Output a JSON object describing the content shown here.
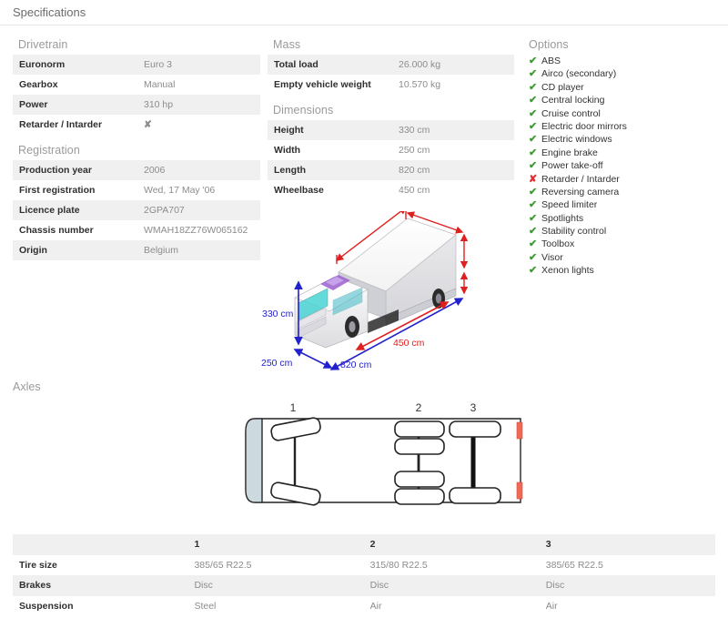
{
  "header": {
    "title": "Specifications"
  },
  "drivetrain": {
    "title": "Drivetrain",
    "rows": [
      {
        "label": "Euronorm",
        "value": "Euro 3"
      },
      {
        "label": "Gearbox",
        "value": "Manual"
      },
      {
        "label": "Power",
        "value": "310 hp"
      },
      {
        "label": "Retarder / Intarder",
        "value": "✘"
      }
    ]
  },
  "registration": {
    "title": "Registration",
    "rows": [
      {
        "label": "Production year",
        "value": "2006"
      },
      {
        "label": "First registration",
        "value": "Wed, 17 May '06"
      },
      {
        "label": "Licence plate",
        "value": "2GPA707"
      },
      {
        "label": "Chassis number",
        "value": "WMAH18ZZ76W065162"
      },
      {
        "label": "Origin",
        "value": "Belgium"
      }
    ]
  },
  "mass": {
    "title": "Mass",
    "rows": [
      {
        "label": "Total load",
        "value": "26.000 kg"
      },
      {
        "label": "Empty vehicle weight",
        "value": "10.570 kg"
      }
    ]
  },
  "dimensions": {
    "title": "Dimensions",
    "rows": [
      {
        "label": "Height",
        "value": "330 cm"
      },
      {
        "label": "Width",
        "value": "250 cm"
      },
      {
        "label": "Length",
        "value": "820 cm"
      },
      {
        "label": "Wheelbase",
        "value": "450 cm"
      }
    ]
  },
  "options": {
    "title": "Options",
    "items": [
      {
        "label": "ABS",
        "present": true
      },
      {
        "label": "Airco (secondary)",
        "present": true
      },
      {
        "label": "CD player",
        "present": true
      },
      {
        "label": "Central locking",
        "present": true
      },
      {
        "label": "Cruise control",
        "present": true
      },
      {
        "label": "Electric door mirrors",
        "present": true
      },
      {
        "label": "Electric windows",
        "present": true
      },
      {
        "label": "Engine brake",
        "present": true
      },
      {
        "label": "Power take-off",
        "present": true
      },
      {
        "label": "Retarder / Intarder",
        "present": false
      },
      {
        "label": "Reversing camera",
        "present": true
      },
      {
        "label": "Speed limiter",
        "present": true
      },
      {
        "label": "Spotlights",
        "present": true
      },
      {
        "label": "Stability control",
        "present": true
      },
      {
        "label": "Toolbox",
        "present": true
      },
      {
        "label": "Visor",
        "present": true
      },
      {
        "label": "Xenon lights",
        "present": true
      }
    ],
    "yes_glyph": "✔",
    "no_glyph": "✘"
  },
  "truck_figure": {
    "height_label": "330 cm",
    "width_label": "250 cm",
    "length_label": "820 cm",
    "wheelbase_label": "450 cm",
    "blue": "#2222cc",
    "red": "#e02020"
  },
  "axles": {
    "title": "Axles",
    "diagram_labels": [
      "1",
      "2",
      "3"
    ],
    "table": {
      "columns": [
        "",
        "1",
        "2",
        "3"
      ],
      "rows": [
        {
          "label": "Tire size",
          "values": [
            "385/65 R22.5",
            "315/80 R22.5",
            "385/65 R22.5"
          ]
        },
        {
          "label": "Brakes",
          "values": [
            "Disc",
            "Disc",
            "Disc"
          ]
        },
        {
          "label": "Suspension",
          "values": [
            "Steel",
            "Air",
            "Air"
          ]
        }
      ]
    }
  }
}
